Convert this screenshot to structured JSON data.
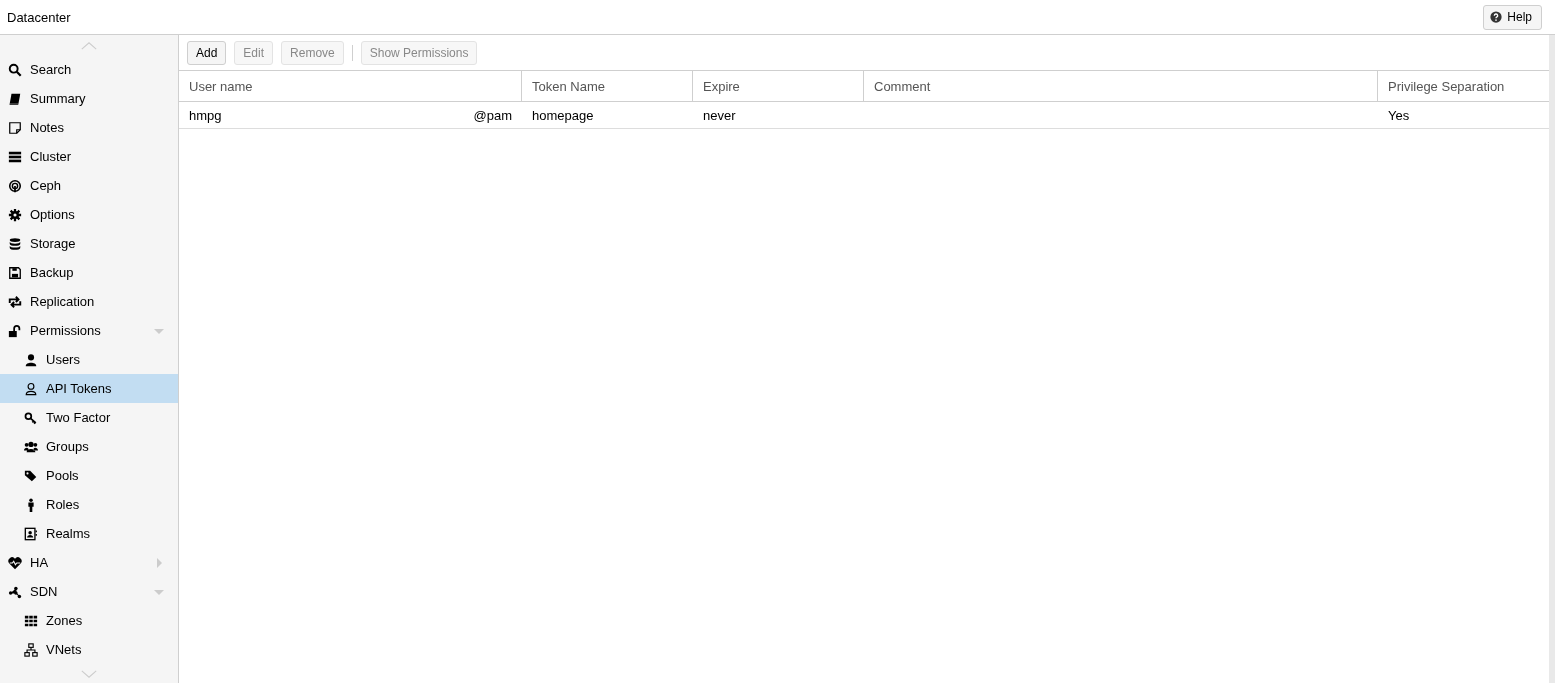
{
  "header": {
    "title": "Datacenter",
    "help_button": "Help"
  },
  "sidebar": {
    "items": [
      {
        "label": "Search",
        "selected": false
      },
      {
        "label": "Summary",
        "selected": false
      },
      {
        "label": "Notes",
        "selected": false
      },
      {
        "label": "Cluster",
        "selected": false
      },
      {
        "label": "Ceph",
        "selected": false
      },
      {
        "label": "Options",
        "selected": false
      },
      {
        "label": "Storage",
        "selected": false
      },
      {
        "label": "Backup",
        "selected": false
      },
      {
        "label": "Replication",
        "selected": false
      },
      {
        "label": "Permissions",
        "selected": false,
        "expanded": true,
        "children": [
          {
            "label": "Users",
            "selected": false
          },
          {
            "label": "API Tokens",
            "selected": true
          },
          {
            "label": "Two Factor",
            "selected": false
          },
          {
            "label": "Groups",
            "selected": false
          },
          {
            "label": "Pools",
            "selected": false
          },
          {
            "label": "Roles",
            "selected": false
          },
          {
            "label": "Realms",
            "selected": false
          }
        ]
      },
      {
        "label": "HA",
        "selected": false,
        "expanded": false
      },
      {
        "label": "SDN",
        "selected": false,
        "expanded": true,
        "children": [
          {
            "label": "Zones",
            "selected": false
          },
          {
            "label": "VNets",
            "selected": false
          }
        ]
      }
    ]
  },
  "toolbar": {
    "buttons": [
      {
        "label": "Add",
        "disabled": false
      },
      {
        "label": "Edit",
        "disabled": true
      },
      {
        "label": "Remove",
        "disabled": true
      },
      {
        "label": "Show Permissions",
        "disabled": true
      }
    ]
  },
  "table": {
    "columns": [
      "User name",
      "Token Name",
      "Expire",
      "Comment",
      "Privilege Separation"
    ],
    "rows": [
      {
        "user": "hmpg",
        "realm": "@pam",
        "token_name": "homepage",
        "expire": "never",
        "privilege_separation": "Yes",
        "selected": false
      }
    ]
  }
}
